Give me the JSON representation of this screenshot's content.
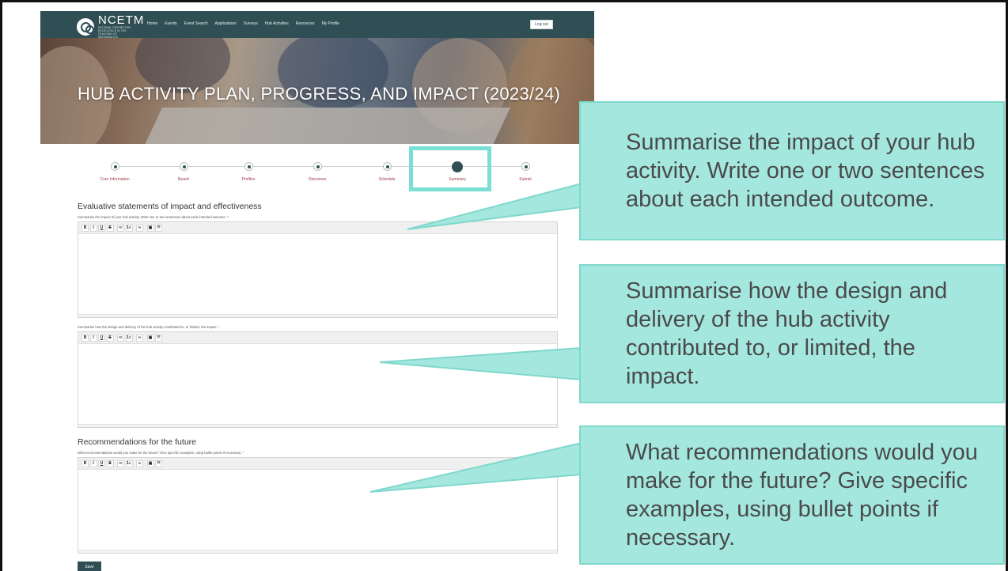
{
  "nav": {
    "logo_name": "NCETM",
    "logo_sub": "NATIONAL CENTRE FOR EXCELLENCE IN THE TEACHING OF MATHEMATICS",
    "links": [
      "Home",
      "Events",
      "Event Search",
      "Applications",
      "Surveys",
      "Hub Activities",
      "Resources",
      "My Profile"
    ],
    "logout": "Log out"
  },
  "hero": {
    "title": "HUB ACTIVITY PLAN, PROGRESS, AND IMPACT (2023/24)"
  },
  "steps": [
    "Core Information",
    "Reach",
    "Profiles",
    "Outcomes",
    "Schedule",
    "Summary",
    "Submit"
  ],
  "active_step": "Summary",
  "sections": {
    "evaluative_heading": "Evaluative statements of impact and effectiveness",
    "impact_label": "Summarise the impact of your hub activity. Write one or two sentences about each intended outcome. *",
    "design_label": "Summarise how the design and delivery of the hub activity contributed to, or limited, the impact. *",
    "recommendations_heading": "Recommendations for the future",
    "recommendations_label": "What recommendations would you make for the future? Give specific examples, using bullet points if necessary. *"
  },
  "toolbar": [
    "B",
    "I",
    "U",
    "S",
    "•≡",
    "1≡",
    "∞",
    "▣",
    "⤧"
  ],
  "save": "Save",
  "callouts": [
    "Summarise the impact of your hub activity. Write one or two sentences about each intended outcome.",
    "Summarise how the design and delivery of the hub activity contributed to, or limited, the impact.",
    "What recommendations would you make for the future? Give specific examples, using bullet points if necessary."
  ],
  "colors": {
    "nav_bg": "#2f4f54",
    "accent_label": "#a0374a",
    "callout_bg": "#a4e7df",
    "highlight": "#79dfd4"
  }
}
